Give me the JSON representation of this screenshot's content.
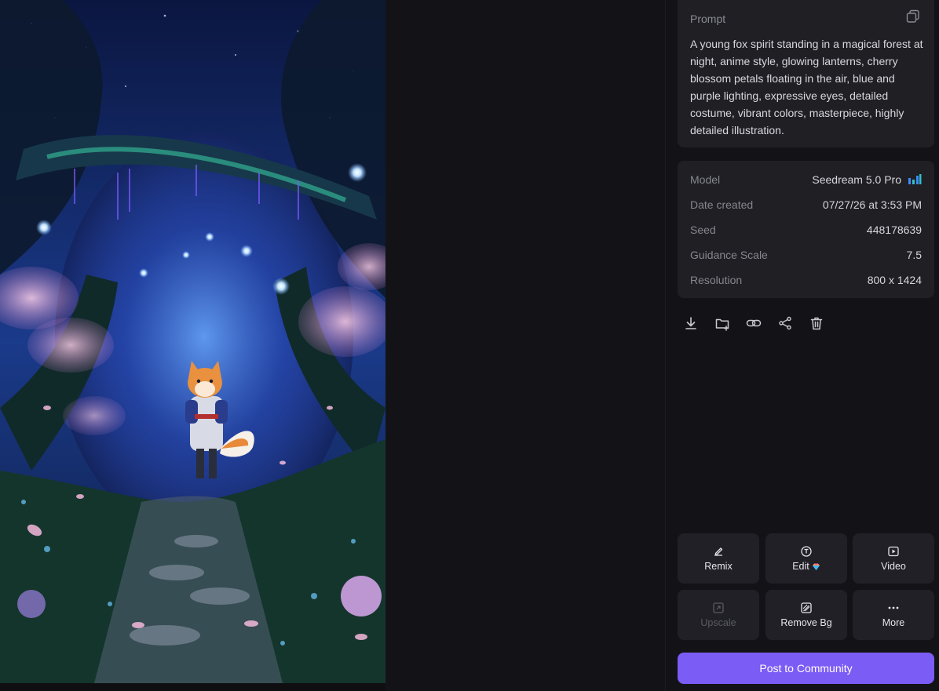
{
  "prompt": {
    "label": "Prompt",
    "text": "A young fox spirit standing in a magical forest at night, anime style, glowing lanterns, cherry blossom petals floating in the air, blue and purple lighting, expressive eyes, detailed costume, vibrant colors, masterpiece, highly detailed illustration."
  },
  "details": [
    {
      "key": "Model",
      "value": "Seedream 5.0 Pro"
    },
    {
      "key": "Date created",
      "value": "07/27/26 at 3:53 PM"
    },
    {
      "key": "Seed",
      "value": "448178639"
    },
    {
      "key": "Guidance Scale",
      "value": "7.5"
    },
    {
      "key": "Resolution",
      "value": "800 x 1424"
    }
  ],
  "actions": [
    "download-icon",
    "add-to-folder-icon",
    "link-icon",
    "share-icon",
    "trash-icon"
  ],
  "tools": {
    "remix": "Remix",
    "edit": "Edit",
    "video": "Video",
    "upscale": "Upscale",
    "remove_bg": "Remove Bg",
    "more": "More"
  },
  "post_button": "Post to Community",
  "colors": {
    "accent": "#7b5cf5",
    "panel": "#131317",
    "card": "#1f1f24"
  }
}
